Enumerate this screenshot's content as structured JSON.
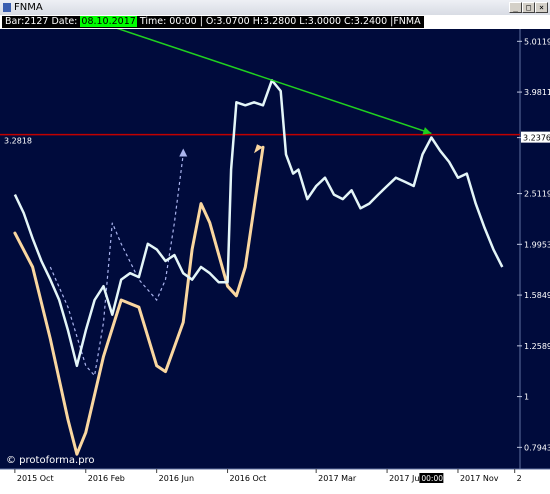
{
  "window": {
    "title": "FNMA",
    "buttons": [
      "_",
      "□",
      "×"
    ]
  },
  "infobar": {
    "bar_prefix": "Bar:2127 Date: ",
    "date": "08.10.2017",
    "rest": " Time: 00:00 | O:3.0700 H:3.2800 L:3.0000 C:3.2400 |FNMA"
  },
  "colors": {
    "background": "#000b3c",
    "price": "#e4f6f8",
    "oscillator": "#fad7a0",
    "dashed_forecast": "#aab4ee",
    "trend_arrow": "#1fd11f",
    "level_line": "#c00000"
  },
  "chart_data": {
    "type": "line",
    "symbol": "FNMA",
    "log_scale": true,
    "grid": false,
    "ylim": [
      0.72,
      5.3
    ],
    "y_ticks": [
      5.0119,
      3.9811,
      3.2376,
      2.5119,
      1.9953,
      1.5849,
      1.2589,
      1.0,
      0.7943
    ],
    "x_ticks": [
      "2015 Oct",
      "2016 Feb",
      "2016 Jun",
      "2016 Oct",
      "2017 Mar",
      "2017 Jul",
      "2017 Nov",
      "2"
    ],
    "x_range_months": [
      -0.5,
      28.5
    ],
    "hline": {
      "value": 3.2818,
      "label": "3.2818"
    },
    "cursor_label": "00:00",
    "watermark": "© protoforma.pro",
    "price_series": [
      {
        "t": 0.0,
        "v": 2.5
      },
      {
        "t": 0.5,
        "v": 2.3
      },
      {
        "t": 1.0,
        "v": 2.05
      },
      {
        "t": 1.5,
        "v": 1.85
      },
      {
        "t": 2.0,
        "v": 1.7
      },
      {
        "t": 2.5,
        "v": 1.55
      },
      {
        "t": 3.0,
        "v": 1.35
      },
      {
        "t": 3.5,
        "v": 1.15
      },
      {
        "t": 4.0,
        "v": 1.35
      },
      {
        "t": 4.5,
        "v": 1.55
      },
      {
        "t": 5.0,
        "v": 1.65
      },
      {
        "t": 5.5,
        "v": 1.45
      },
      {
        "t": 6.0,
        "v": 1.7
      },
      {
        "t": 6.5,
        "v": 1.75
      },
      {
        "t": 7.0,
        "v": 1.72
      },
      {
        "t": 7.5,
        "v": 2.0
      },
      {
        "t": 8.0,
        "v": 1.95
      },
      {
        "t": 8.5,
        "v": 1.85
      },
      {
        "t": 9.0,
        "v": 1.9
      },
      {
        "t": 9.5,
        "v": 1.75
      },
      {
        "t": 10.0,
        "v": 1.7
      },
      {
        "t": 10.5,
        "v": 1.8
      },
      {
        "t": 11.0,
        "v": 1.75
      },
      {
        "t": 11.5,
        "v": 1.68
      },
      {
        "t": 12.0,
        "v": 1.68
      },
      {
        "t": 12.2,
        "v": 2.8
      },
      {
        "t": 12.5,
        "v": 3.8
      },
      {
        "t": 13.0,
        "v": 3.75
      },
      {
        "t": 13.5,
        "v": 3.8
      },
      {
        "t": 14.0,
        "v": 3.75
      },
      {
        "t": 14.5,
        "v": 4.2
      },
      {
        "t": 15.0,
        "v": 4.0
      },
      {
        "t": 15.3,
        "v": 3.0
      },
      {
        "t": 15.7,
        "v": 2.75
      },
      {
        "t": 16.0,
        "v": 2.8
      },
      {
        "t": 16.5,
        "v": 2.45
      },
      {
        "t": 17.0,
        "v": 2.6
      },
      {
        "t": 17.5,
        "v": 2.7
      },
      {
        "t": 18.0,
        "v": 2.5
      },
      {
        "t": 18.5,
        "v": 2.45
      },
      {
        "t": 19.0,
        "v": 2.55
      },
      {
        "t": 19.5,
        "v": 2.35
      },
      {
        "t": 20.0,
        "v": 2.4
      },
      {
        "t": 20.5,
        "v": 2.5
      },
      {
        "t": 21.0,
        "v": 2.6
      },
      {
        "t": 21.5,
        "v": 2.7
      },
      {
        "t": 22.0,
        "v": 2.65
      },
      {
        "t": 22.5,
        "v": 2.6
      },
      {
        "t": 23.0,
        "v": 3.0
      },
      {
        "t": 23.5,
        "v": 3.24
      },
      {
        "t": 24.0,
        "v": 3.05
      },
      {
        "t": 24.5,
        "v": 2.9
      },
      {
        "t": 25.0,
        "v": 2.7
      },
      {
        "t": 25.5,
        "v": 2.75
      },
      {
        "t": 26.0,
        "v": 2.4
      },
      {
        "t": 26.5,
        "v": 2.15
      },
      {
        "t": 27.0,
        "v": 1.95
      },
      {
        "t": 27.5,
        "v": 1.8
      }
    ],
    "oscillator_series": [
      {
        "t": 0.0,
        "v": 2.1
      },
      {
        "t": 1.0,
        "v": 1.8
      },
      {
        "t": 2.0,
        "v": 1.3
      },
      {
        "t": 3.0,
        "v": 0.9
      },
      {
        "t": 3.5,
        "v": 0.77
      },
      {
        "t": 4.0,
        "v": 0.85
      },
      {
        "t": 5.0,
        "v": 1.2
      },
      {
        "t": 6.0,
        "v": 1.55
      },
      {
        "t": 7.0,
        "v": 1.5
      },
      {
        "t": 8.0,
        "v": 1.15
      },
      {
        "t": 8.5,
        "v": 1.12
      },
      {
        "t": 9.5,
        "v": 1.4
      },
      {
        "t": 10.0,
        "v": 1.95
      },
      {
        "t": 10.5,
        "v": 2.4
      },
      {
        "t": 11.0,
        "v": 2.2
      },
      {
        "t": 12.0,
        "v": 1.65
      },
      {
        "t": 12.5,
        "v": 1.58
      },
      {
        "t": 13.0,
        "v": 1.8
      },
      {
        "t": 14.0,
        "v": 3.1
      }
    ],
    "dashed_forecast": [
      {
        "t": 2.0,
        "v": 1.8
      },
      {
        "t": 3.0,
        "v": 1.5
      },
      {
        "t": 4.0,
        "v": 1.15
      },
      {
        "t": 4.5,
        "v": 1.1
      },
      {
        "t": 5.0,
        "v": 1.4
      },
      {
        "t": 5.5,
        "v": 2.2
      },
      {
        "t": 6.0,
        "v": 2.0
      },
      {
        "t": 7.0,
        "v": 1.7
      },
      {
        "t": 8.0,
        "v": 1.55
      },
      {
        "t": 8.5,
        "v": 1.7
      },
      {
        "t": 9.0,
        "v": 2.2
      },
      {
        "t": 9.5,
        "v": 3.0
      }
    ],
    "trend_arrow": {
      "from": {
        "t": 4.5,
        "v": 5.5
      },
      "to": {
        "t": 23.5,
        "v": 3.3
      }
    }
  }
}
